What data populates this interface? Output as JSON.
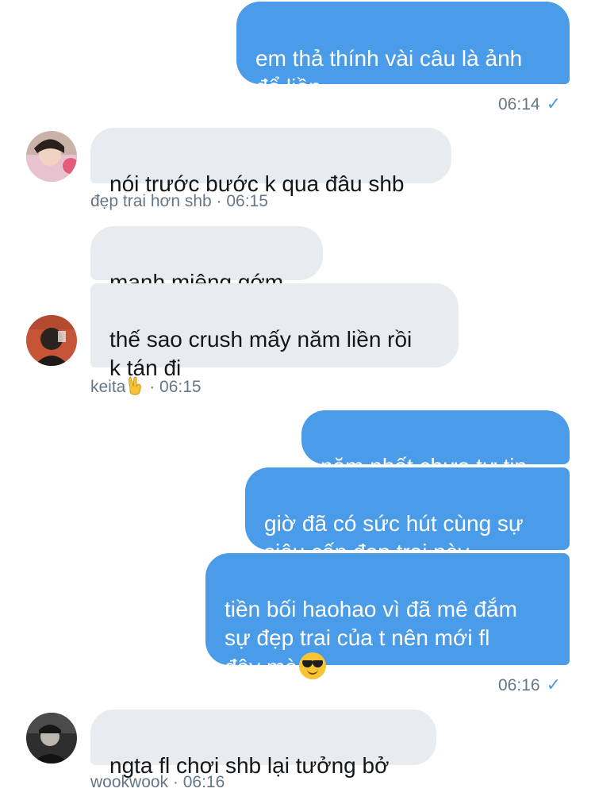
{
  "messages": [
    {
      "text": "em thả thính vài câu là ảnh\nđổ liền"
    },
    {
      "text": "nói trước bước k qua đâu shb"
    },
    {
      "text": "mạnh miệng gớm"
    },
    {
      "text": "thế sao crush mấy năm liền rồi\nk tán đi"
    },
    {
      "text": "năm nhất chưa tự tin"
    },
    {
      "text": "giờ đã có sức hút cùng sự\nsiêu cấp đẹp trai này"
    },
    {
      "text": "tiền bối haohao vì đã mê đắm\nsự đẹp trai của t nên mới fl\nđây mà"
    },
    {
      "text": "ngta fl chơi shb lại tưởng bở"
    }
  ],
  "meta": {
    "m1": "06:14",
    "m2": "đẹp trai hơn shb · 06:15",
    "m3_name": "keita",
    "m3_time": " · 06:15",
    "m4": "06:16",
    "m5": "wookwook · 06:16"
  },
  "colors": {
    "outgoing": "#4a9be8",
    "incoming": "#e6ecf0",
    "meta_text": "#657786"
  },
  "icons": {
    "read_receipt": "check-icon",
    "emoji_1": "sunglasses-emoji",
    "emoji_2": "victory-hand-emoji"
  }
}
